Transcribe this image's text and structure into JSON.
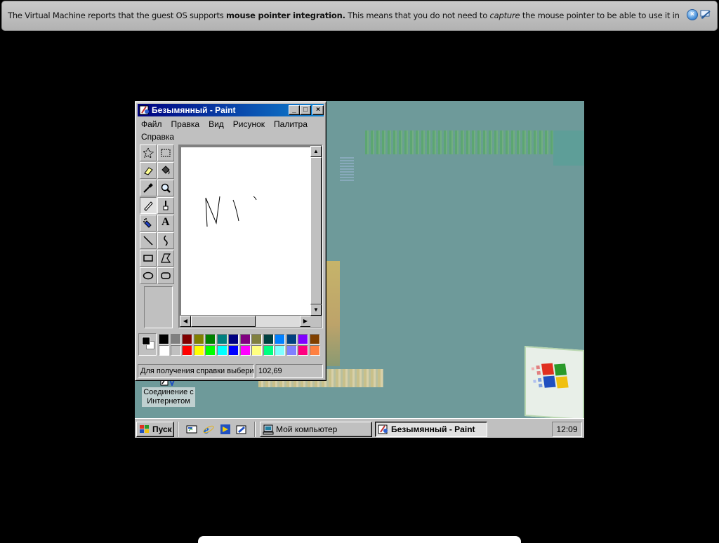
{
  "vm_notification": {
    "text_part1": "The Virtual Machine reports that the guest OS supports ",
    "text_bold": "mouse pointer integration.",
    "text_part2": " This means that you do not need to ",
    "text_italic": "capture",
    "text_part3": " the mouse pointer to be able to use it in your guest OS -- all mouse",
    "close_icon": "close-circle-icon",
    "dont_show_icon": "no-notification-icon"
  },
  "paint": {
    "title": "Безымянный - Paint",
    "menu": [
      "Файл",
      "Правка",
      "Вид",
      "Рисунок",
      "Палитра",
      "Справка"
    ],
    "tools": [
      "free-select-icon",
      "rect-select-icon",
      "eraser-icon",
      "fill-bucket-icon",
      "color-picker-icon",
      "magnifier-icon",
      "pencil-icon",
      "brush-icon",
      "airbrush-icon",
      "text-icon",
      "line-icon",
      "curve-icon",
      "rectangle-icon",
      "polygon-icon",
      "ellipse-icon",
      "rounded-rect-icon"
    ],
    "active_tool": "pencil-icon",
    "text_tool_glyph": "A",
    "foreground_color": "#000000",
    "background_color": "#ffffff",
    "palette_row1": [
      "#000000",
      "#808080",
      "#800000",
      "#808000",
      "#008000",
      "#008080",
      "#000080",
      "#800080",
      "#808040",
      "#004040",
      "#0080ff",
      "#004080",
      "#8000ff",
      "#804000"
    ],
    "palette_row2": [
      "#ffffff",
      "#c0c0c0",
      "#ff0000",
      "#ffff00",
      "#00ff00",
      "#00ffff",
      "#0000ff",
      "#ff00ff",
      "#ffff80",
      "#00ff80",
      "#80ffff",
      "#8080ff",
      "#ff0080",
      "#ff8040"
    ],
    "status_help": "Для получения справки выбери",
    "status_coords": "102,69"
  },
  "desktop": {
    "icon_label_line1": "Соединение с",
    "icon_label_line2": "Интернетом"
  },
  "taskbar": {
    "start_label": "Пуск",
    "quick_launch": [
      "show-desktop-icon",
      "internet-explorer-icon",
      "channels-icon",
      "outlook-express-icon"
    ],
    "tasks": [
      {
        "label": "Мой компьютер",
        "active": false
      },
      {
        "label": "Безымянный - Paint",
        "active": true
      }
    ],
    "clock": "12:09"
  }
}
